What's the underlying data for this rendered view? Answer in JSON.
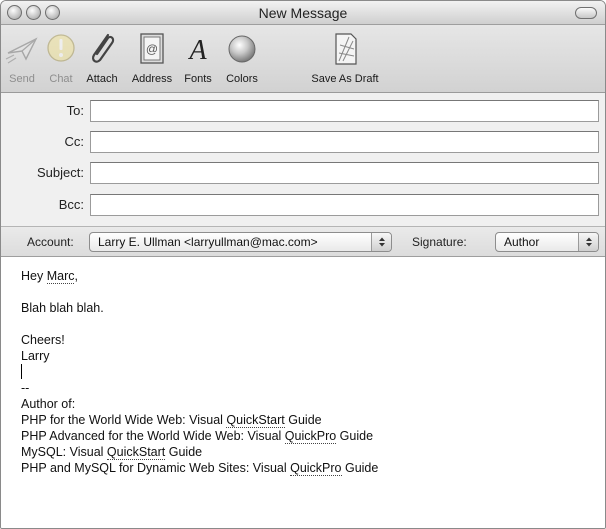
{
  "window": {
    "title": "New Message"
  },
  "toolbar": {
    "items": [
      {
        "label": "Send",
        "icon": "send-icon",
        "enabled": false
      },
      {
        "label": "Chat",
        "icon": "chat-icon",
        "enabled": false
      },
      {
        "label": "Attach",
        "icon": "paperclip-icon",
        "enabled": true
      },
      {
        "label": "Address",
        "icon": "address-book-icon",
        "enabled": true
      },
      {
        "label": "Fonts",
        "icon": "fonts-icon",
        "enabled": true
      },
      {
        "label": "Colors",
        "icon": "color-wheel-icon",
        "enabled": true
      },
      {
        "label": "Save As Draft",
        "icon": "save-draft-icon",
        "enabled": true
      }
    ]
  },
  "fields": {
    "to": {
      "label": "To:",
      "value": ""
    },
    "cc": {
      "label": "Cc:",
      "value": ""
    },
    "subject": {
      "label": "Subject:",
      "value": ""
    },
    "bcc": {
      "label": "Bcc:",
      "value": ""
    }
  },
  "account": {
    "label": "Account:",
    "value": "Larry E. Ullman <larryullman@mac.com>",
    "signature_label": "Signature:",
    "signature_value": "Author"
  },
  "message": {
    "greeting_prefix": "Hey ",
    "greeting_name": "Marc",
    "greeting_suffix": ",",
    "body_line": "Blah blah blah.",
    "closing": "Cheers!",
    "name": "Larry",
    "sig_separator": "--",
    "sig_heading": "Author of:",
    "books": [
      {
        "pre": "PHP for the World Wide Web: Visual ",
        "flag": "QuickStart",
        "post": " Guide"
      },
      {
        "pre": "PHP Advanced for the World Wide Web: Visual ",
        "flag": "QuickPro",
        "post": " Guide"
      },
      {
        "pre": "MySQL: Visual ",
        "flag": "QuickStart",
        "post": " Guide"
      },
      {
        "pre": "PHP and MySQL for Dynamic Web Sites: Visual ",
        "flag": "QuickPro",
        "post": " Guide"
      }
    ]
  }
}
